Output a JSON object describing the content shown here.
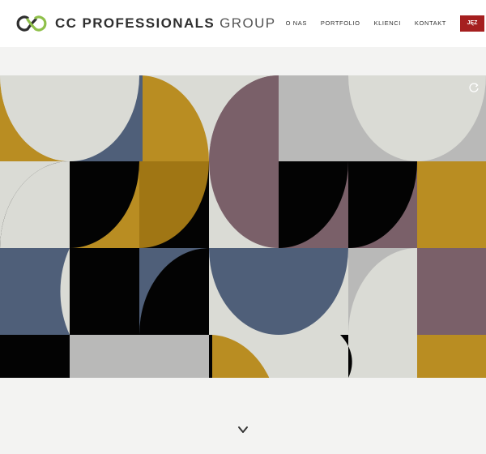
{
  "brand": {
    "name_bold": "CC PROFESSIONALS",
    "name_light": "GROUP",
    "logo_icon": "cc-infinity-logo"
  },
  "nav": {
    "items": [
      {
        "label": "O NAS"
      },
      {
        "label": "PORTFOLIO"
      },
      {
        "label": "KLIENCI"
      },
      {
        "label": "KONTAKT"
      }
    ],
    "language_label": "JĘZ"
  },
  "hero": {
    "artwork": "geometric-pattern",
    "reload_icon": "refresh-icon"
  },
  "scroll_icon": "chevron-down-icon",
  "colors": {
    "accent_red": "#a51f1f",
    "gold": "#b98d22",
    "slate_blue": "#4f5f79",
    "mauve": "#7a6069",
    "cream": "#dadbd5",
    "gray": "#b9b9b8",
    "black": "#030303"
  }
}
